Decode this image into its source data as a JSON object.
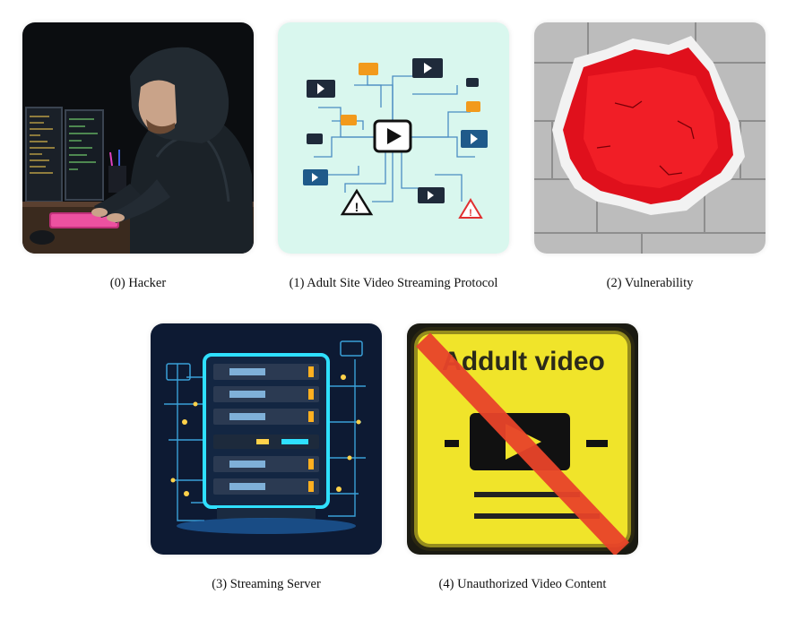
{
  "panels": [
    {
      "caption": "(0) Hacker",
      "icon": "hooded-hacker-at-keyboard"
    },
    {
      "caption": "(1) Adult Site Video Streaming Protocol",
      "icon": "video-network-diagram"
    },
    {
      "caption": "(2) Vulnerability",
      "icon": "red-hole-in-brick-wall"
    },
    {
      "caption": "(3) Streaming Server",
      "icon": "neon-server-rack"
    },
    {
      "caption": "(4) Unauthorized Video Content",
      "icon": "crossed-out-video-sign"
    }
  ],
  "sign_text": "Addult video",
  "colors": {
    "hole_red": "#e0101c",
    "sign_yellow": "#f0e42a",
    "diagram_bg": "#d9f7ee",
    "server_cyan": "#2fe0ff"
  }
}
